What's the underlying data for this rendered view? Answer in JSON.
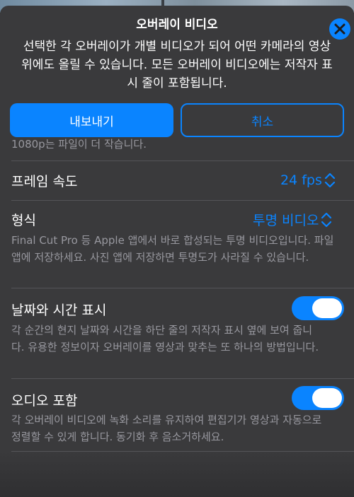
{
  "header": {
    "title": "오버레이 비디오",
    "description": "선택한 각 오버레이가 개별 비디오가 되어 어떤 카메라의 영상 위에도 올릴 수 있습니다. 모든 오버레이 비디오에는 저작자 표시 줄이 포함됩니다."
  },
  "actions": {
    "export_label": "내보내기",
    "cancel_label": "취소"
  },
  "resolution_note": "1080p는 파일이 더 작습니다.",
  "frame_rate": {
    "label": "프레임 속도",
    "value": "24 fps"
  },
  "format": {
    "label": "형식",
    "value": "투명 비디오",
    "caption": "Final Cut Pro 등 Apple 앱에서 바로 합성되는 투명 비디오입니다. 파일 앱에 저장하세요. 사진 앱에 저장하면 투명도가 사라질 수 있습니다."
  },
  "datetime": {
    "label": "날짜와 시간 표시",
    "enabled": true,
    "caption": "각 순간의 현지 날짜와 시간을 하단 줄의 저작자 표시 옆에 보여 줍니다. 유용한 정보이자 오버레이를 영상과 맞추는 또 하나의 방법입니다."
  },
  "audio": {
    "label": "오디오 포함",
    "enabled": true,
    "caption": "각 오버레이 비디오에 녹화 소리를 유지하여 편집기가 영상과 자동으로 정렬할 수 있게 합니다. 동기화 후 음소거하세요."
  },
  "colors": {
    "accent": "#0a84ff",
    "sheet": "#3a3a3c",
    "secondary_text": "#98989f"
  },
  "icons": {
    "close": "close-icon",
    "chevron": "chevron-up-down-icon"
  }
}
